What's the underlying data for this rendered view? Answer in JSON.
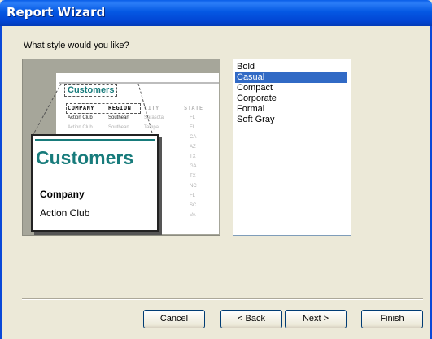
{
  "window": {
    "title": "Report Wizard"
  },
  "prompt": "What style would you like?",
  "preview": {
    "small_title": "Customers",
    "headers": [
      "COMPANY",
      "REGION",
      "CITY",
      "STATE"
    ],
    "row1": [
      "Action Club",
      "Southeart",
      "Sarasota",
      "FL"
    ],
    "row2": [
      "Action Club",
      "Southeart",
      "Tampa",
      "FL"
    ],
    "states": [
      "CA",
      "AZ",
      "TX",
      "GA",
      "TX",
      "NC",
      "FL",
      "SC",
      "VA"
    ],
    "zoom_title": "Customers",
    "zoom_company": "Company",
    "zoom_value": "Action Club",
    "accent_color": "#177b7b"
  },
  "styles": {
    "items": [
      "Bold",
      "Casual",
      "Compact",
      "Corporate",
      "Formal",
      "Soft Gray"
    ],
    "selected": "Casual"
  },
  "buttons": {
    "cancel": "Cancel",
    "back": "< Back",
    "next": "Next >",
    "finish": "Finish"
  }
}
